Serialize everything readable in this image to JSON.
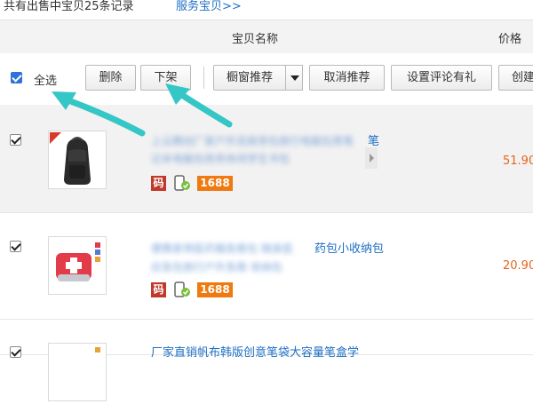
{
  "summary": {
    "count_text": "共有出售中宝贝25条记录",
    "link_text": "服务宝贝>>"
  },
  "header": {
    "name_col": "宝贝名称",
    "price_col": "价格"
  },
  "toolbar": {
    "select_all": "全选",
    "delete": "删除",
    "takedown": "下架",
    "window_recommend": "橱窗推荐",
    "cancel_recommend": "取消推荐",
    "set_review_gift": "设置评论有礼",
    "create": "创建"
  },
  "items": [
    {
      "title_visible": "笔",
      "title_blurred": "上云腾创厂家户外双肩背包旅行电脑包男笔",
      "subtitle_blurred": "记本电脑包商务休闲学生书包",
      "price": "51.90",
      "badges": {
        "ma": "码",
        "b1688": "1688"
      },
      "checked": true,
      "image": "black-backpack"
    },
    {
      "title_visible": "药包小收纳包",
      "title_blurred": "便携家用医药箱急救包 随身医",
      "subtitle_blurred": "应急包旅行户外急救 收纳包",
      "price": "20.90",
      "badges": {
        "ma": "码",
        "b1688": "1688"
      },
      "checked": true,
      "image": "first-aid-kit"
    },
    {
      "title_visible": "厂家直销帆布韩版创意笔袋大容量笔盒学",
      "checked": true,
      "image": "pencil-case"
    }
  ],
  "colors": {
    "link": "#1e6fc4",
    "price": "#e8641b",
    "arrow": "#35c6c6",
    "badge_1688": "#f07a12",
    "badge_ma": "#c0392b"
  }
}
